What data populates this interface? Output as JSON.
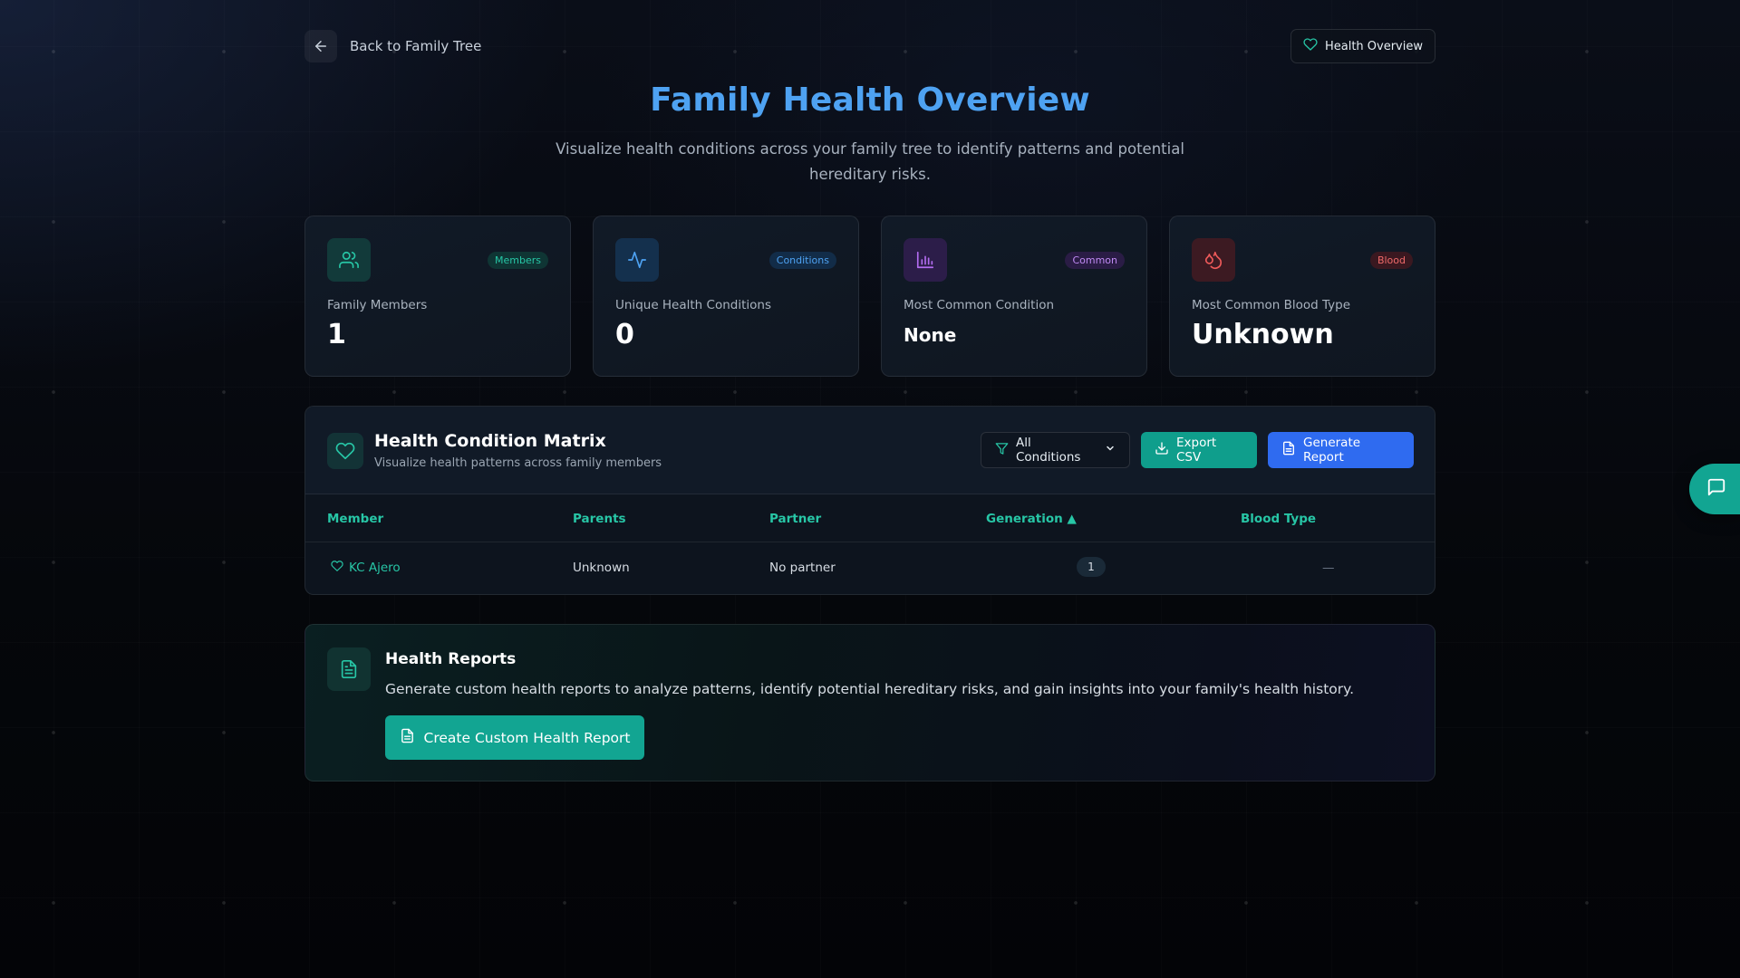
{
  "topbar": {
    "back_label": "Back to Family Tree",
    "badge_label": "Health Overview"
  },
  "header": {
    "title": "Family Health Overview",
    "subtitle": "Visualize health conditions across your family tree to identify patterns and potential hereditary risks."
  },
  "stats": [
    {
      "tag": "Members",
      "label": "Family Members",
      "value": "1",
      "icon": "users-icon",
      "color": "#27c6a6"
    },
    {
      "tag": "Conditions",
      "label": "Unique Health Conditions",
      "value": "0",
      "icon": "activity-icon",
      "color": "#4ea2f2"
    },
    {
      "tag": "Common",
      "label": "Most Common Condition",
      "value": "None",
      "icon": "bar-chart-icon",
      "color": "#b36cf0"
    },
    {
      "tag": "Blood",
      "label": "Most Common Blood Type",
      "value": "Unknown",
      "icon": "droplet-icon",
      "color": "#ef5a5a"
    }
  ],
  "matrix": {
    "title": "Health Condition Matrix",
    "subtitle": "Visualize health patterns across family members",
    "filter_label": "All Conditions",
    "export_label": "Export CSV",
    "report_label": "Generate Report",
    "columns": [
      "Member",
      "Parents",
      "Partner",
      "Generation ▲",
      "Blood Type"
    ],
    "rows": [
      {
        "member": "KC Ajero",
        "parents": "Unknown",
        "partner": "No partner",
        "generation": "1",
        "blood_type": "—"
      }
    ]
  },
  "reports": {
    "title": "Health Reports",
    "description": "Generate custom health reports to analyze patterns, identify potential hereditary risks, and gain insights into your family's health history.",
    "cta_label": "Create Custom Health Report"
  },
  "colors": {
    "accent_teal": "#12a592",
    "accent_blue": "#2f6bf0",
    "title_blue": "#4ea2f2"
  }
}
